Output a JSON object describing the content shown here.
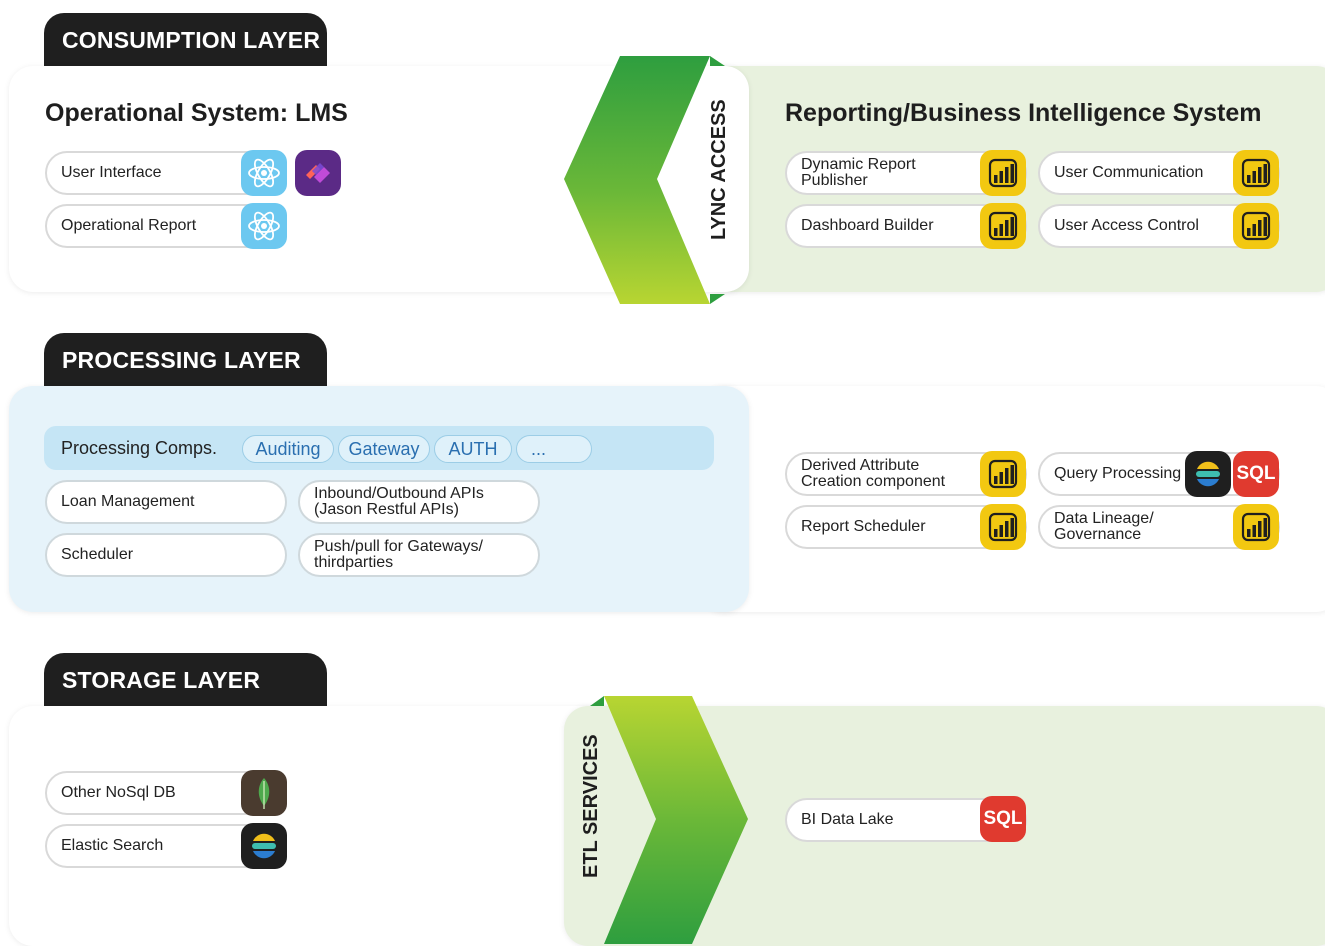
{
  "consumption": {
    "tab": "CONSUMPTION LAYER",
    "left_title": "Operational System: LMS",
    "user_interface": "User Interface",
    "operational_report": "Operational Report",
    "lync_access": "LYNC ACCESS",
    "right_title": "Reporting/Business Intelligence System",
    "dynamic_report_publisher": "Dynamic Report\nPublisher",
    "user_communication": "User Communication",
    "dashboard_builder": "Dashboard Builder",
    "user_access_control": "User Access Control"
  },
  "processing": {
    "tab": "PROCESSING LAYER",
    "comps_label": "Processing Comps.",
    "chips": [
      "Auditing",
      "Gateway",
      "AUTH",
      "..."
    ],
    "loan_management": "Loan Management",
    "inbound_outbound": "Inbound/Outbound APIs\n(Jason Restful APIs)",
    "scheduler": "Scheduler",
    "push_pull": "Push/pull for Gateways/\nthirdparties",
    "derived_attribute": "Derived Attribute\nCreation component",
    "query_processing": "Query Processing",
    "report_scheduler": "Report Scheduler",
    "data_lineage": "Data Lineage/\nGovernance"
  },
  "storage": {
    "tab": "STORAGE LAYER",
    "other_nosql": "Other NoSql DB",
    "elastic_search": "Elastic Search",
    "etl_services": "ETL SERVICES",
    "bi_data_lake": "BI Data Lake"
  },
  "icons": {
    "sql_text": "SQL",
    "react": "react-icon",
    "power_bi": "power-bi-icon",
    "sql": "sql-icon",
    "elastic": "elastic-icon",
    "mongo": "mongodb-icon",
    "kendo": "kendo-icon"
  },
  "colors": {
    "tab_bg": "#1f1f1f",
    "green_panel": "#e8f1de",
    "blue_panel": "#e6f3fa",
    "chevron_dark": "#3aa53c",
    "chevron_light": "#b5d334",
    "react": "#6cc8f0",
    "power_bi": "#f2c811",
    "sql": "#e03a2f"
  }
}
